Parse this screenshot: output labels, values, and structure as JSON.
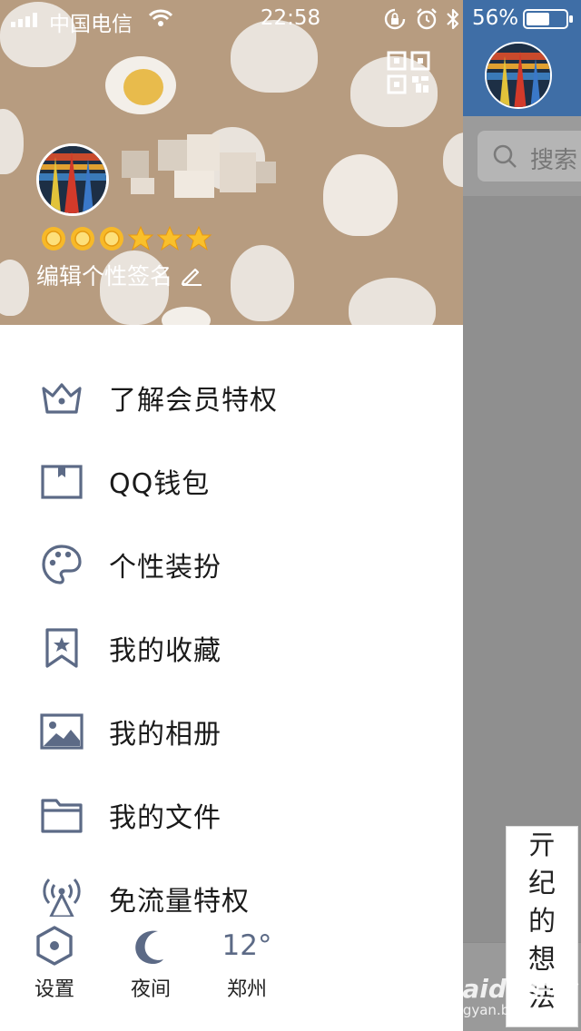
{
  "status_bar": {
    "carrier": "中国电信",
    "time": "22:58",
    "battery": "56%"
  },
  "main_screen": {
    "search_placeholder": "搜索"
  },
  "profile": {
    "signature": "编辑个性签名",
    "level_icons": [
      "sun-icon",
      "sun-icon",
      "sun-icon",
      "star-icon",
      "star-icon",
      "star-icon"
    ]
  },
  "menu": [
    {
      "icon": "crown-icon",
      "label": "了解会员特权"
    },
    {
      "icon": "wallet-icon",
      "label": "QQ钱包"
    },
    {
      "icon": "palette-icon",
      "label": "个性装扮"
    },
    {
      "icon": "bookmark-star-icon",
      "label": "我的收藏"
    },
    {
      "icon": "image-icon",
      "label": "我的相册"
    },
    {
      "icon": "folder-icon",
      "label": "我的文件"
    },
    {
      "icon": "antenna-icon",
      "label": "免流量特权"
    }
  ],
  "bottom_bar": {
    "settings": "设置",
    "night": "夜间",
    "temperature": "12°",
    "city": "郑州"
  },
  "watermark": {
    "note_chars": [
      "亓",
      "纪",
      "的",
      "想",
      "法"
    ],
    "baidu_logo": "Baidu经验",
    "baidu_url": "jingyan.baidu.com"
  },
  "colors": {
    "header_bg": "#b79c80",
    "icon": "#5c6a86",
    "main_header": "#3f6ea6"
  }
}
